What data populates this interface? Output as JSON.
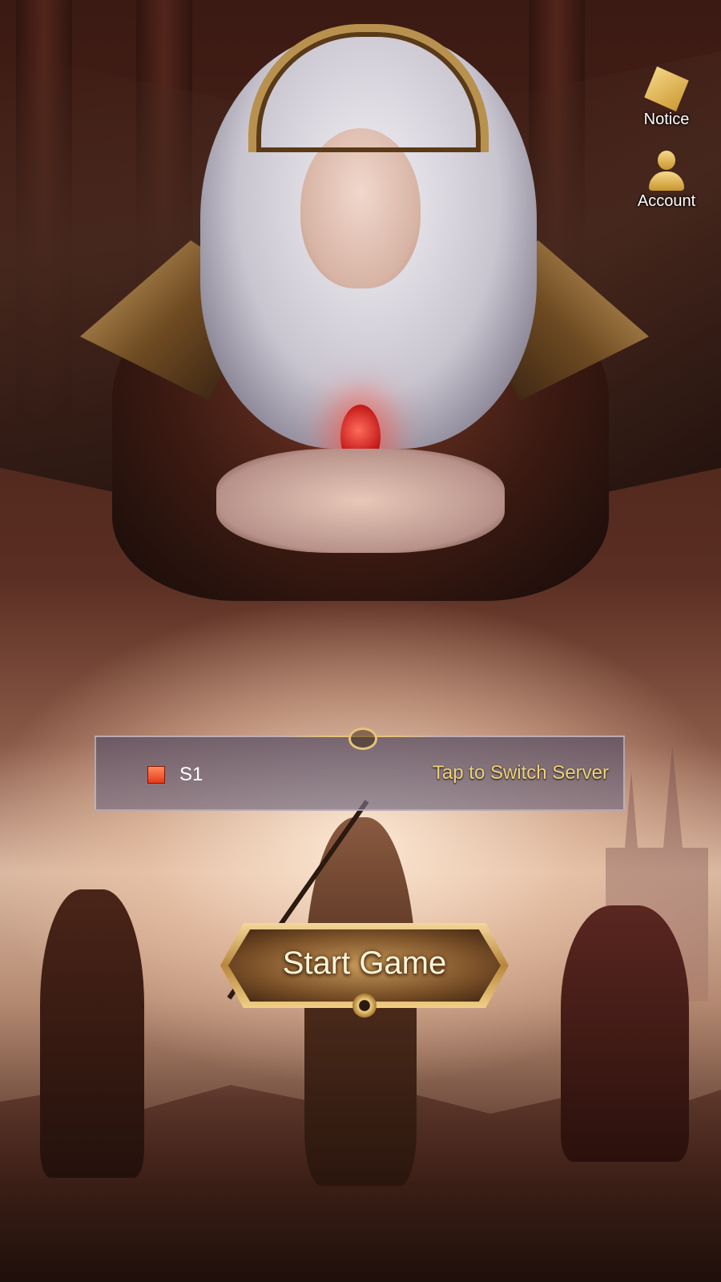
{
  "top_menu": {
    "notice_label": "Notice",
    "account_label": "Account"
  },
  "server": {
    "name": "S1",
    "switch_label": "Tap to Switch Server",
    "status_color": "#f04a20"
  },
  "start_button": {
    "label": "Start Game"
  },
  "colors": {
    "accent_gold": "#e8c27a",
    "text_gold": "#f0d27a"
  }
}
